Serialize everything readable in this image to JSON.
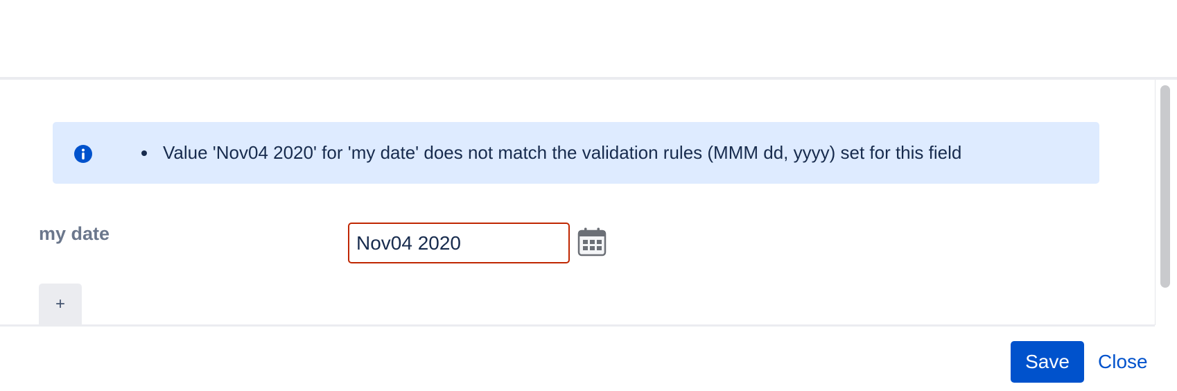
{
  "dialog": {
    "message": {
      "icon": "info-icon",
      "items": [
        "Value 'Nov04 2020' for 'my date' does not match the validation rules (MMM dd, yyyy) set for this field"
      ]
    },
    "field": {
      "label": "my date",
      "value": "Nov04 2020",
      "calendar_icon": "calendar-icon"
    },
    "add_button_label": "+",
    "footer": {
      "save_label": "Save",
      "close_label": "Close"
    }
  },
  "colors": {
    "primary": "#0052cc",
    "info_background": "#deebff",
    "error_border": "#bf2600",
    "text": "#172b4d",
    "label_text": "#6b778c"
  }
}
